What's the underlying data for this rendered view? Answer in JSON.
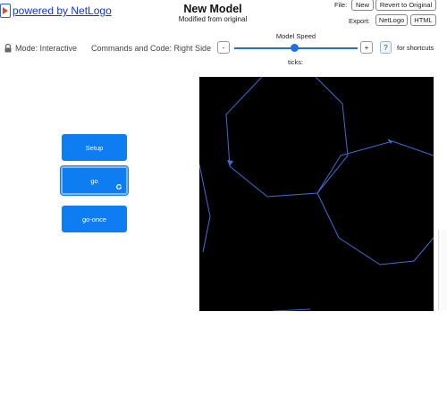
{
  "header": {
    "logo_text": "powered by NetLogo",
    "title": "New Model",
    "subtitle": "Modified from original",
    "file_label": "File:",
    "file_new": "New",
    "file_revert": "Revert to Original",
    "export_label": "Export:",
    "export_netlogo": "NetLogo",
    "export_html": "HTML"
  },
  "toolbar": {
    "mode": "Mode: Interactive",
    "commands": "Commands and Code: Right Side",
    "speed_label": "Model Speed",
    "speed_minus": "-",
    "speed_plus": "+",
    "speed_value": 0.5,
    "ticks_label": "ticks:",
    "help": "?",
    "shortcuts": "for shortcuts"
  },
  "buttons": {
    "setup": "Setup",
    "go": "go",
    "go_once": "go-once"
  },
  "colors": {
    "button_blue": "#0f7df2",
    "view_background": "#000000",
    "turtle_path": "#3b6fd4",
    "link_blue": "#0b38d9"
  },
  "icons": {
    "lock": "lock-icon",
    "repeat": "repeat-icon",
    "logo": "netlogo-logo-icon"
  }
}
